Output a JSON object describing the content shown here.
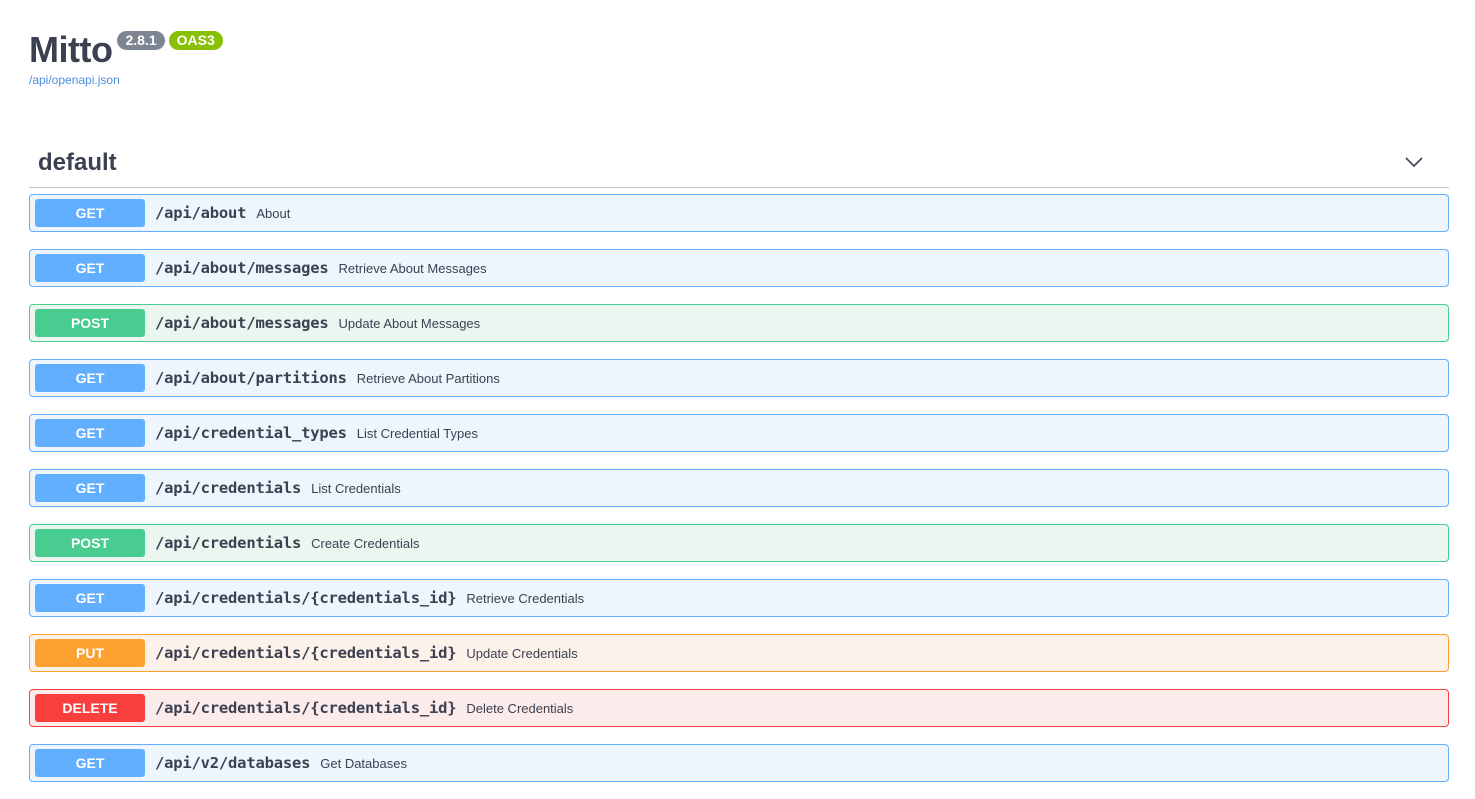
{
  "info": {
    "title": "Mitto",
    "version": "2.8.1",
    "oas_badge": "OAS3",
    "spec_url": "/api/openapi.json"
  },
  "section": {
    "title": "default",
    "toggle_icon": "chevron-down-icon"
  },
  "operations": [
    {
      "method": "GET",
      "path": "/api/about",
      "summary": "About"
    },
    {
      "method": "GET",
      "path": "/api/about/messages",
      "summary": "Retrieve About Messages"
    },
    {
      "method": "POST",
      "path": "/api/about/messages",
      "summary": "Update About Messages"
    },
    {
      "method": "GET",
      "path": "/api/about/partitions",
      "summary": "Retrieve About Partitions"
    },
    {
      "method": "GET",
      "path": "/api/credential_types",
      "summary": "List Credential Types"
    },
    {
      "method": "GET",
      "path": "/api/credentials",
      "summary": "List Credentials"
    },
    {
      "method": "POST",
      "path": "/api/credentials",
      "summary": "Create Credentials"
    },
    {
      "method": "GET",
      "path": "/api/credentials/{credentials_id}",
      "summary": "Retrieve Credentials"
    },
    {
      "method": "PUT",
      "path": "/api/credentials/{credentials_id}",
      "summary": "Update Credentials"
    },
    {
      "method": "DELETE",
      "path": "/api/credentials/{credentials_id}",
      "summary": "Delete Credentials"
    },
    {
      "method": "GET",
      "path": "/api/v2/databases",
      "summary": "Get Databases"
    }
  ],
  "colors": {
    "get": "#61affe",
    "post": "#49cc90",
    "put": "#fca130",
    "delete": "#f93e3e",
    "text": "#3b4151",
    "link": "#4990e2"
  }
}
